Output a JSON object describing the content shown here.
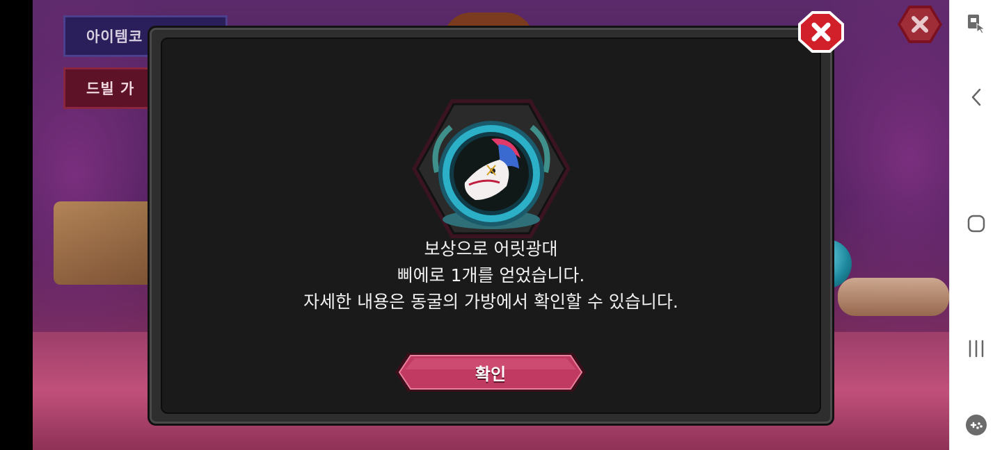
{
  "background": {
    "buttons": [
      {
        "label": "아이템코"
      },
      {
        "label": "드빌 가"
      }
    ]
  },
  "dialog": {
    "message_lines": [
      "보상으로 어릿광대",
      "삐에로 1개를 얻었습니다.",
      "자세한 내용은 동굴의 가방에서 확인할 수 있습니다."
    ],
    "confirm_label": "확인",
    "reward_icon": "clown-dragon-emblem-icon"
  },
  "system_nav": {
    "icons": [
      "screenshot-touch-icon",
      "back-icon",
      "home-icon",
      "recents-icon",
      "game-tools-icon"
    ]
  },
  "colors": {
    "dialog_bg": "#1a1a1a",
    "confirm_button": "#c03a62",
    "close_button": "#d2202a"
  }
}
